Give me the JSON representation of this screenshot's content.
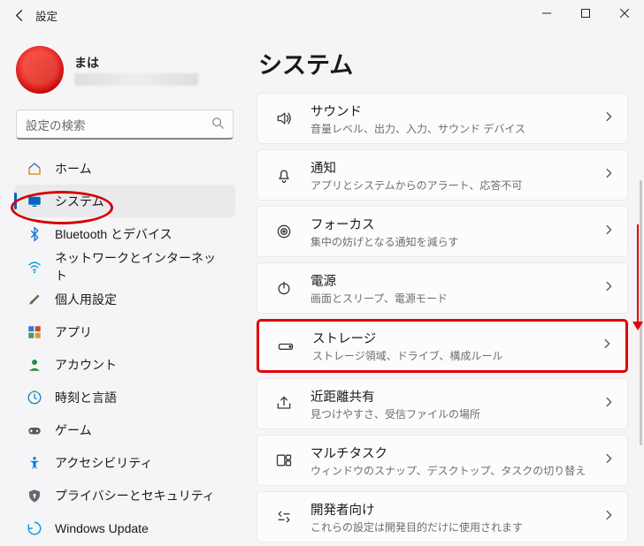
{
  "window": {
    "back_tooltip": "戻る",
    "title": "設定"
  },
  "profile": {
    "name": "まは"
  },
  "search": {
    "placeholder": "設定の検索"
  },
  "sidebar": {
    "items": [
      {
        "label": "ホーム",
        "icon": "home"
      },
      {
        "label": "システム",
        "icon": "system",
        "selected": true
      },
      {
        "label": "Bluetooth とデバイス",
        "icon": "bluetooth"
      },
      {
        "label": "ネットワークとインターネット",
        "icon": "wifi"
      },
      {
        "label": "個人用設定",
        "icon": "brush"
      },
      {
        "label": "アプリ",
        "icon": "apps"
      },
      {
        "label": "アカウント",
        "icon": "account"
      },
      {
        "label": "時刻と言語",
        "icon": "time"
      },
      {
        "label": "ゲーム",
        "icon": "game"
      },
      {
        "label": "アクセシビリティ",
        "icon": "access"
      },
      {
        "label": "プライバシーとセキュリティ",
        "icon": "privacy"
      },
      {
        "label": "Windows Update",
        "icon": "update"
      }
    ]
  },
  "page": {
    "title": "システム"
  },
  "cards": [
    {
      "icon": "sound",
      "title": "サウンド",
      "desc": "音量レベル、出力、入力、サウンド デバイス"
    },
    {
      "icon": "bell",
      "title": "通知",
      "desc": "アプリとシステムからのアラート、応答不可"
    },
    {
      "icon": "focus",
      "title": "フォーカス",
      "desc": "集中の妨げとなる通知を減らす"
    },
    {
      "icon": "power",
      "title": "電源",
      "desc": "画面とスリープ、電源モード"
    },
    {
      "icon": "storage",
      "title": "ストレージ",
      "desc": "ストレージ領域、ドライブ、構成ルール",
      "highlight": true
    },
    {
      "icon": "share",
      "title": "近距離共有",
      "desc": "見つけやすさ、受信ファイルの場所"
    },
    {
      "icon": "multitask",
      "title": "マルチタスク",
      "desc": "ウィンドウのスナップ、デスクトップ、タスクの切り替え"
    },
    {
      "icon": "dev",
      "title": "開発者向け",
      "desc": "これらの設定は開発目的だけに使用されます"
    }
  ]
}
